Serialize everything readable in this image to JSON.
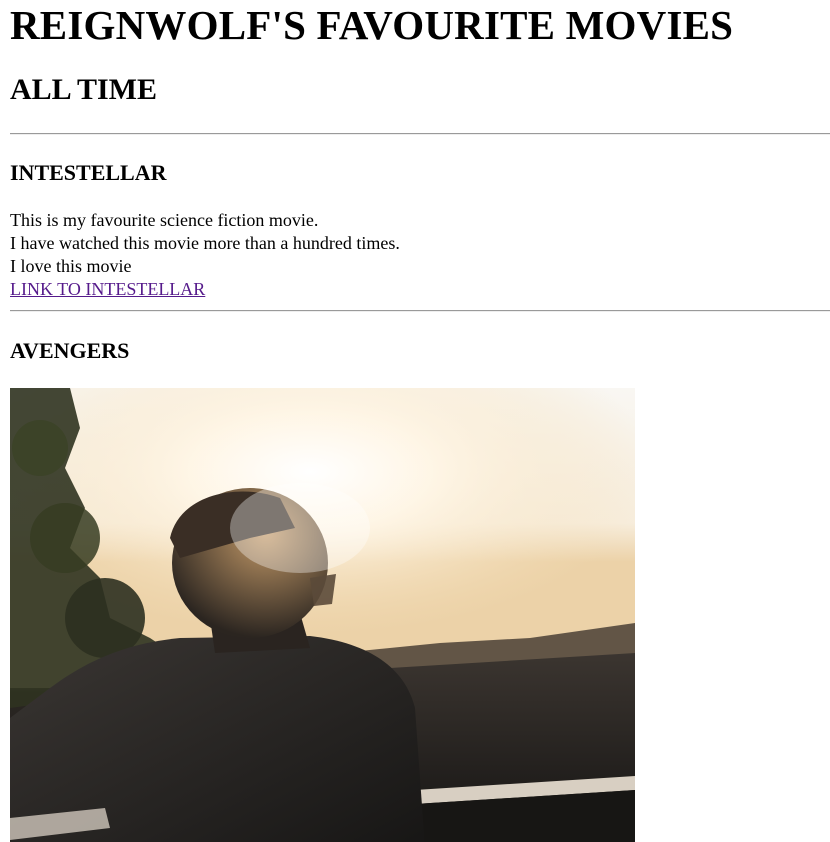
{
  "header": {
    "title": "REIGNWOLF'S FAVOURITE MOVIES",
    "subtitle": "ALL TIME"
  },
  "movies": [
    {
      "title": "INTESTELLAR",
      "lines": [
        "This is my favourite science fiction movie.",
        "I have watched this movie more than a hundred times.",
        "I love this movie"
      ],
      "link_label": "LINK TO INTESTELLAR"
    },
    {
      "title": "AVENGERS"
    }
  ],
  "colors": {
    "link_visited": "#551a8b",
    "divider": "#9a9a9a"
  }
}
